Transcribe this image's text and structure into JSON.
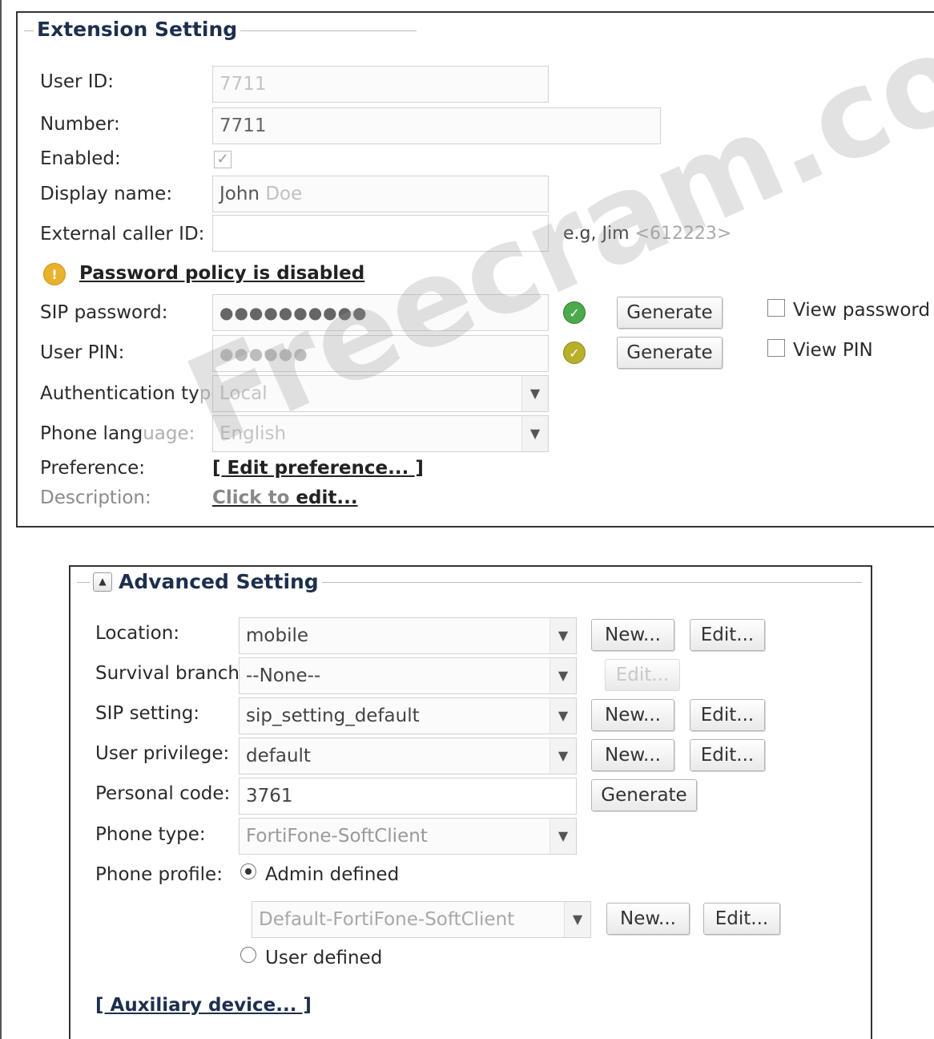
{
  "extension": {
    "legend": "Extension Setting",
    "user_id": {
      "label": "User ID:",
      "value": "7711"
    },
    "number": {
      "label": "Number:",
      "value": "7711"
    },
    "enabled": {
      "label": "Enabled:"
    },
    "display_name": {
      "label": "Display name:",
      "value_main": "John",
      "value_soft": " Doe"
    },
    "external_caller_id": {
      "label": "External caller ID:",
      "value": "",
      "hint_main": "e.g, Jim",
      "hint_soft": " <612223>"
    },
    "password_policy": {
      "text": "Password policy is disabled",
      "icon": "warning-icon",
      "icon_color": "#e8b22a"
    },
    "sip_password": {
      "label": "SIP password:",
      "value": "●●●●●●●●●●",
      "generate": "Generate",
      "view_label": "View password",
      "status_color": "#4caa4c"
    },
    "user_pin": {
      "label": "User PIN:",
      "value": "●●●●●●",
      "generate": "Generate",
      "view_label": "View PIN",
      "status_color": "#b8b02a"
    },
    "auth_type": {
      "label_main": "Authentication ty",
      "label_soft": "pe:",
      "value": "Local"
    },
    "phone_language": {
      "label_main": "Phone lang",
      "label_soft": "uage:",
      "value": "English"
    },
    "preference": {
      "label": "Preference:",
      "link": "[ Edit preference... ]"
    },
    "description": {
      "label": "Description:",
      "link_main": "Click to",
      "link_bold": " edit..."
    }
  },
  "advanced": {
    "legend": "Advanced Setting",
    "location": {
      "label": "Location:",
      "value": "mobile",
      "new": "New...",
      "edit": "Edit..."
    },
    "survival_branch": {
      "label": "Survival branch:",
      "value": "--None--",
      "edit": "Edit..."
    },
    "sip_setting": {
      "label": "SIP setting:",
      "value": "sip_setting_default",
      "new": "New...",
      "edit": "Edit..."
    },
    "user_privilege": {
      "label": "User privilege:",
      "value": "default",
      "new": "New...",
      "edit": "Edit..."
    },
    "personal_code": {
      "label": "Personal code:",
      "value": "3761",
      "generate": "Generate"
    },
    "phone_type": {
      "label": "Phone type:",
      "value": "FortiFone-SoftClient"
    },
    "phone_profile": {
      "label": "Phone profile:",
      "admin_defined": "Admin defined",
      "user_defined": "User defined",
      "profile_value": "Default-FortiFone-SoftClient",
      "new": "New...",
      "edit": "Edit..."
    },
    "auxiliary_link": "[ Auxiliary device... ]"
  },
  "watermark": "Freecram.com"
}
